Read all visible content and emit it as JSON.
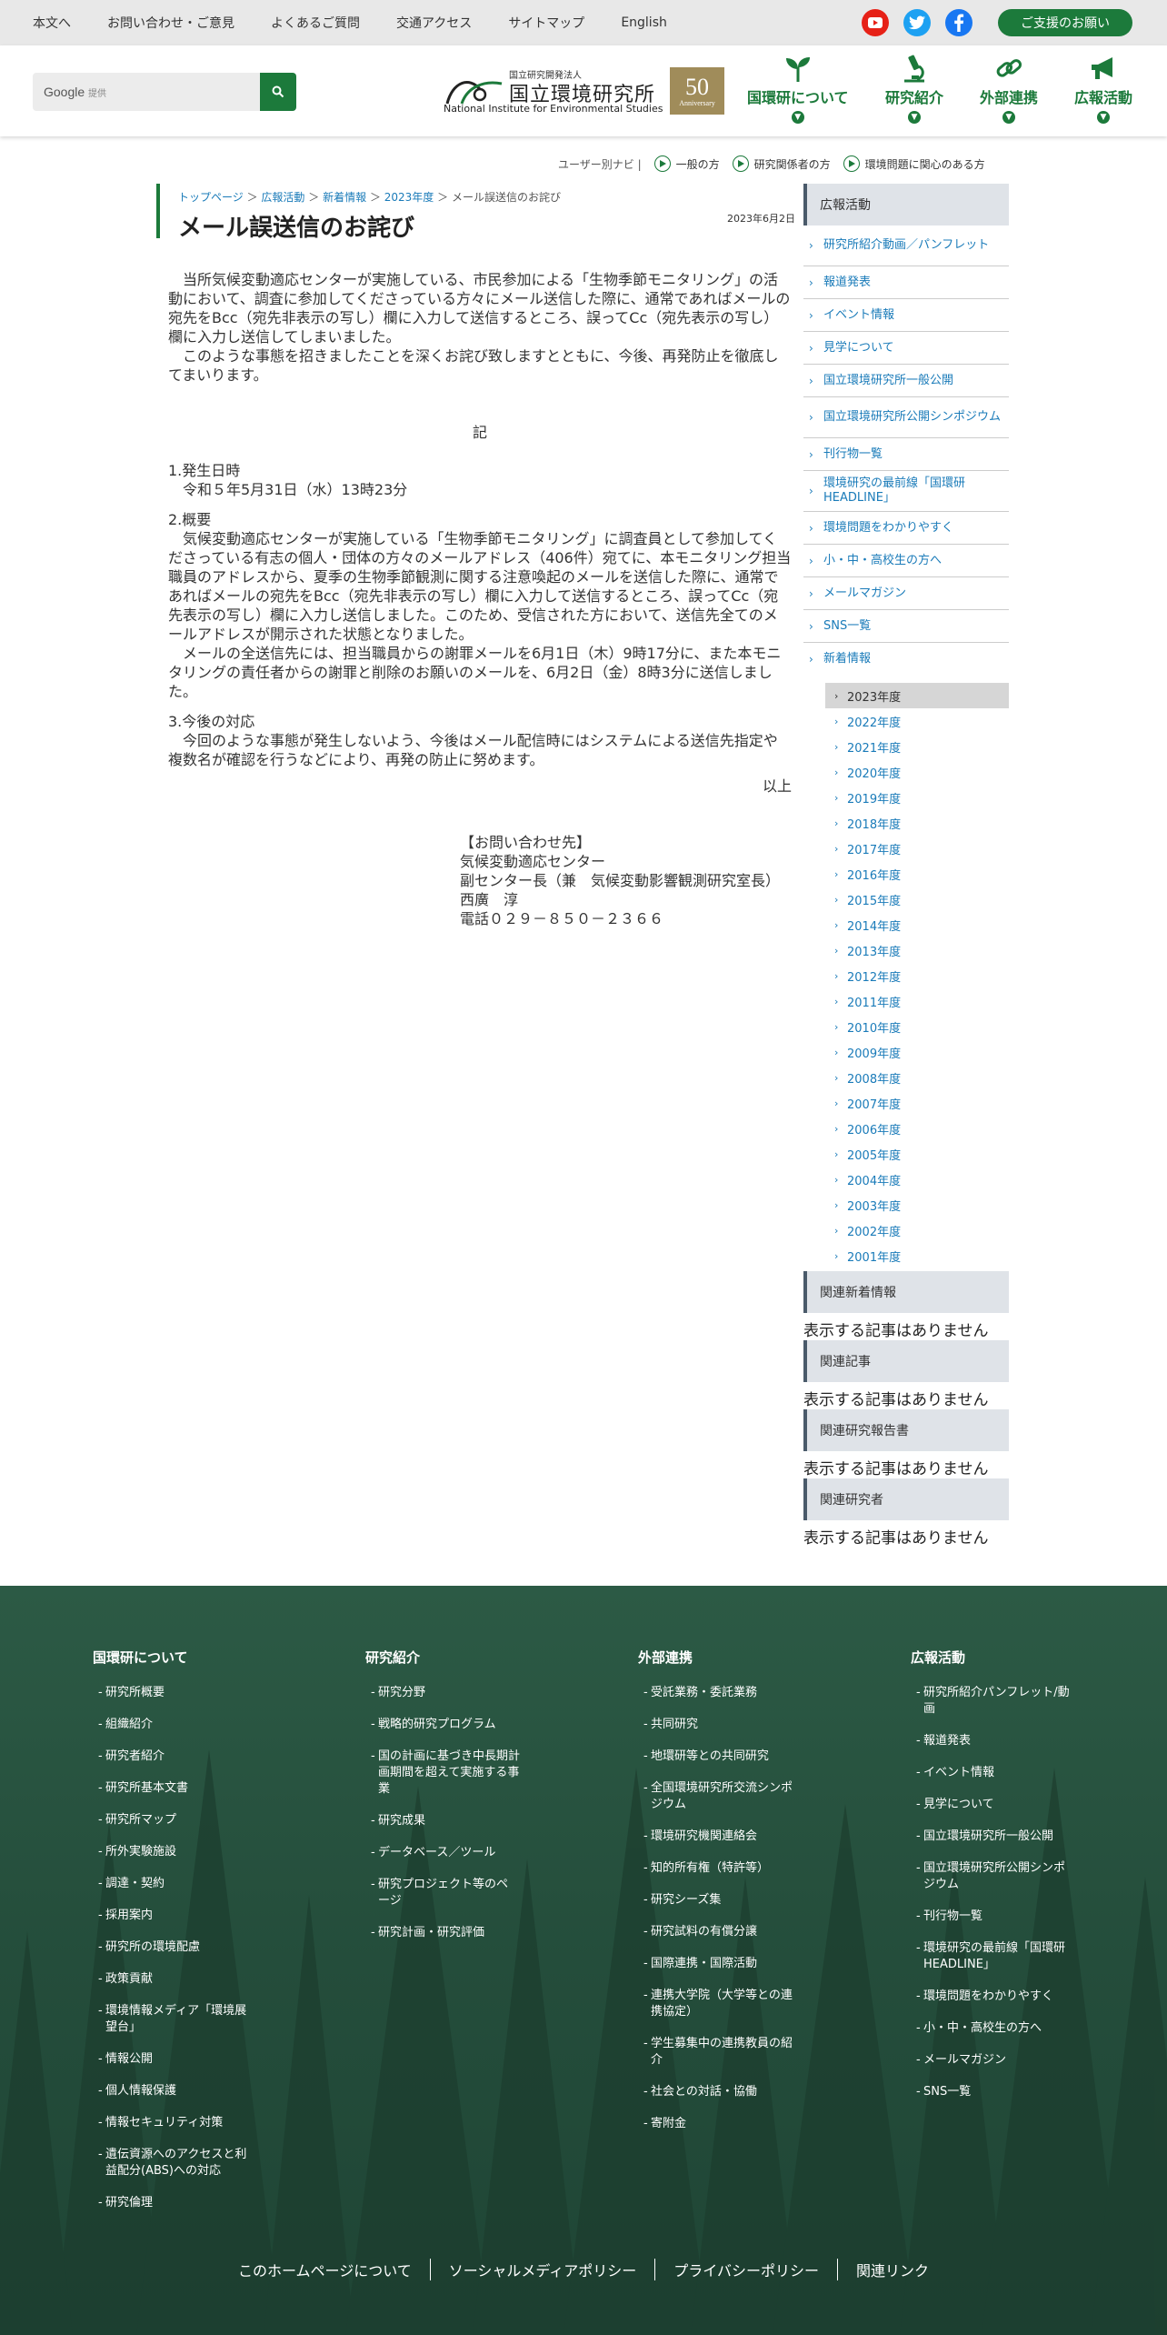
{
  "utility": {
    "links": [
      "本文へ",
      "お問い合わせ・ご意見",
      "よくあるご質問",
      "交通アクセス",
      "サイトマップ",
      "English"
    ],
    "support": "ご支援のお願い"
  },
  "header": {
    "search_brand": "Google",
    "search_sub": "提供",
    "logo_sub": "国立研究開発法人",
    "logo_main": "国立環境研究所",
    "logo_en": "National Institute for Environmental Studies",
    "anniv_num": "50",
    "anniv_text": "Anniversary",
    "nav": [
      "国環研について",
      "研究紹介",
      "外部連携",
      "広報活動"
    ]
  },
  "usernavi": {
    "label": "ユーザー別ナビ",
    "items": [
      "一般の方",
      "研究関係者の方",
      "環境問題に関心のある方"
    ]
  },
  "breadcrumb": [
    "トップページ",
    "広報活動",
    "新着情報",
    "2023年度",
    "メール誤送信のお詫び"
  ],
  "page": {
    "title": "メール誤送信のお詫び",
    "date": "2023年6月2日"
  },
  "article": {
    "intro1": "　当所気候変動適応センターが実施している、市民参加による「生物季節モニタリング」の活動において、調査に参加してくださっている方々にメール送信した際に、通常であればメールの宛先をBcc（宛先非表示の写し）欄に入力して送信するところ、誤ってCc（宛先表示の写し）欄に入力し送信してしまいました。",
    "intro2": "　このような事態を招きましたことを深くお詫び致しますとともに、今後、再発防止を徹底してまいります。",
    "ki": "記",
    "s1_head": "1.発生日時",
    "s1_body": "　令和５年5月31日（水）13時23分",
    "s2_head": "2.概要",
    "s2_body1": "　気候変動適応センターが実施している「生物季節モニタリング」に調査員として参加してくださっている有志の個人・団体の方々のメールアドレス（406件）宛てに、本モニタリング担当職員のアドレスから、夏季の生物季節観測に関する注意喚起のメールを送信した際に、通常であればメールの宛先をBcc（宛先非表示の写し）欄に入力して送信するところ、誤ってCc（宛先表示の写し）欄に入力し送信しました。このため、受信された方において、送信先全てのメールアドレスが開示された状態となりました。",
    "s2_body2": "　メールの全送信先には、担当職員からの謝罪メールを6月1日（木）9時17分に、また本モニタリングの責任者からの謝罪と削除のお願いのメールを、6月2日（金）8時3分に送信しました。",
    "s3_head": "3.今後の対応",
    "s3_body": "　今回のような事態が発生しないよう、今後はメール配信時にはシステムによる送信先指定や複数名が確認を行うなどにより、再発の防止に努めます。",
    "ijo": "以上"
  },
  "contact": [
    "【お問い合わせ先】",
    "気候変動適応センター",
    "副センター長（兼　気候変動影響観測研究室長）",
    "西廣　淳",
    "電話０２９－８５０－２３６６"
  ],
  "sidebar": {
    "head": "広報活動",
    "items": [
      "研究所紹介動画／パンフレット",
      "報道発表",
      "イベント情報",
      "見学について",
      "国立環境研究所一般公開",
      "国立環境研究所公開シンポジウム",
      "刊行物一覧",
      "環境研究の最前線「国環研HEADLINE」",
      "環境問題をわかりやすく",
      "小・中・高校生の方へ",
      "メールマガジン",
      "SNS一覧",
      "新着情報"
    ],
    "years": [
      "2023年度",
      "2022年度",
      "2021年度",
      "2020年度",
      "2019年度",
      "2018年度",
      "2017年度",
      "2016年度",
      "2015年度",
      "2014年度",
      "2013年度",
      "2012年度",
      "2011年度",
      "2010年度",
      "2009年度",
      "2008年度",
      "2007年度",
      "2006年度",
      "2005年度",
      "2004年度",
      "2003年度",
      "2002年度",
      "2001年度"
    ],
    "related": [
      {
        "head": "関連新着情報",
        "empty": "表示する記事はありません"
      },
      {
        "head": "関連記事",
        "empty": "表示する記事はありません"
      },
      {
        "head": "関連研究報告書",
        "empty": "表示する記事はありません"
      },
      {
        "head": "関連研究者",
        "empty": "表示する記事はありません"
      }
    ]
  },
  "footer": {
    "col1": {
      "head": "国環研について",
      "items": [
        "研究所概要",
        "組織紹介",
        "研究者紹介",
        "研究所基本文書",
        "研究所マップ",
        "所外実験施設",
        "調達・契約",
        "採用案内",
        "研究所の環境配慮",
        "政策貢献",
        "環境情報メディア「環境展望台」",
        "情報公開",
        "個人情報保護",
        "情報セキュリティ対策",
        "遺伝資源へのアクセスと利益配分(ABS)への対応",
        "研究倫理"
      ]
    },
    "col2": {
      "head": "研究紹介",
      "items": [
        "研究分野",
        "戦略的研究プログラム",
        "国の計画に基づき中長期計画期間を超えて実施する事業",
        "研究成果",
        "データベース／ツール",
        "研究プロジェクト等のページ",
        "研究計画・研究評価"
      ]
    },
    "col3": {
      "head": "外部連携",
      "items": [
        "受託業務・委託業務",
        "共同研究",
        "地環研等との共同研究",
        "全国環境研究所交流シンポジウム",
        "環境研究機関連絡会",
        "知的所有権（特許等）",
        "研究シーズ集",
        "研究試料の有償分譲",
        "国際連携・国際活動",
        "連携大学院（大学等との連携協定）",
        "学生募集中の連携教員の紹介",
        "社会との対話・協働",
        "寄附金"
      ]
    },
    "col4": {
      "head": "広報活動",
      "items": [
        "研究所紹介パンフレット/動画",
        "報道発表",
        "イベント情報",
        "見学について",
        "国立環境研究所一般公開",
        "国立環境研究所公開シンポジウム",
        "刊行物一覧",
        "環境研究の最前線「国環研HEADLINE」",
        "環境問題をわかりやすく",
        "小・中・高校生の方へ",
        "メールマガジン",
        "SNS一覧"
      ]
    },
    "bottom": [
      "このホームページについて",
      "ソーシャルメディアポリシー",
      "プライバシーポリシー",
      "関連リンク"
    ]
  },
  "colors": {
    "brand_green": "#1c7a3b",
    "link_blue": "#1a7bb9",
    "footer_green": "#2c5a45"
  }
}
